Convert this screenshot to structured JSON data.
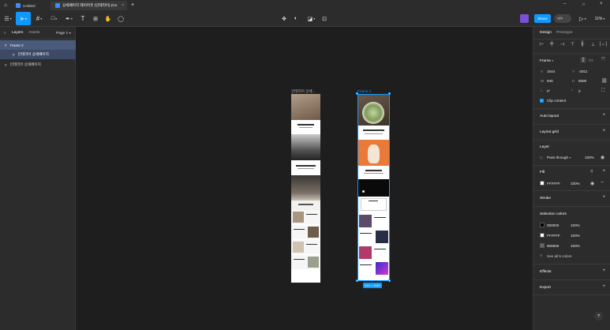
{
  "tabs": [
    {
      "label": "Untitled",
      "active": false
    },
    {
      "label": "상세페이지 레이아웃 (인테리어) (Co",
      "active": true
    }
  ],
  "toolbar": {
    "share_label": "Share",
    "zoom": "11%"
  },
  "left_panel": {
    "tabs": [
      "Layers",
      "Assets"
    ],
    "page": "Page 1",
    "layers": [
      {
        "label": "Frame 2",
        "selected": true
      },
      {
        "label": "인테리어 상세페이지",
        "selected": true
      },
      {
        "label": "인테리어 상세페이지",
        "selected": false
      }
    ]
  },
  "canvas": {
    "frame1_label": "인테리어 상세...",
    "frame2_label": "Frame 2",
    "dimensions": "946 × 5590"
  },
  "right_panel": {
    "tabs": [
      "Design",
      "Prototype"
    ],
    "frame_title": "Frame",
    "x_label": "X",
    "x_value": "1544",
    "y_label": "Y",
    "y_value": "-2811",
    "w_label": "W",
    "w_value": "946",
    "h_label": "H",
    "h_value": "5590",
    "rotation": "0°",
    "radius": "0",
    "clip_content": "Clip content",
    "auto_layout": "Auto layout",
    "layout_grid": "Layout grid",
    "layer_title": "Layer",
    "blend_mode": "Pass through",
    "layer_opacity": "100%",
    "fill_title": "Fill",
    "fill_hex": "FFFFFF",
    "fill_opacity": "100%",
    "stroke_title": "Stroke",
    "selection_colors_title": "Selection colors",
    "selection_colors": [
      {
        "hex": "000000",
        "opacity": "100%",
        "color": "#000000"
      },
      {
        "hex": "FFFFFF",
        "opacity": "100%",
        "color": "#FFFFFF"
      },
      {
        "hex": "666666",
        "opacity": "100%",
        "color": "#666666"
      }
    ],
    "see_all": "See all 5 colors",
    "effects_title": "Effects",
    "export_title": "Export"
  },
  "help": "?",
  "colors": {
    "accent": "#0d99ff",
    "panel": "#2c2c2c",
    "canvas": "#1e1e1e"
  }
}
